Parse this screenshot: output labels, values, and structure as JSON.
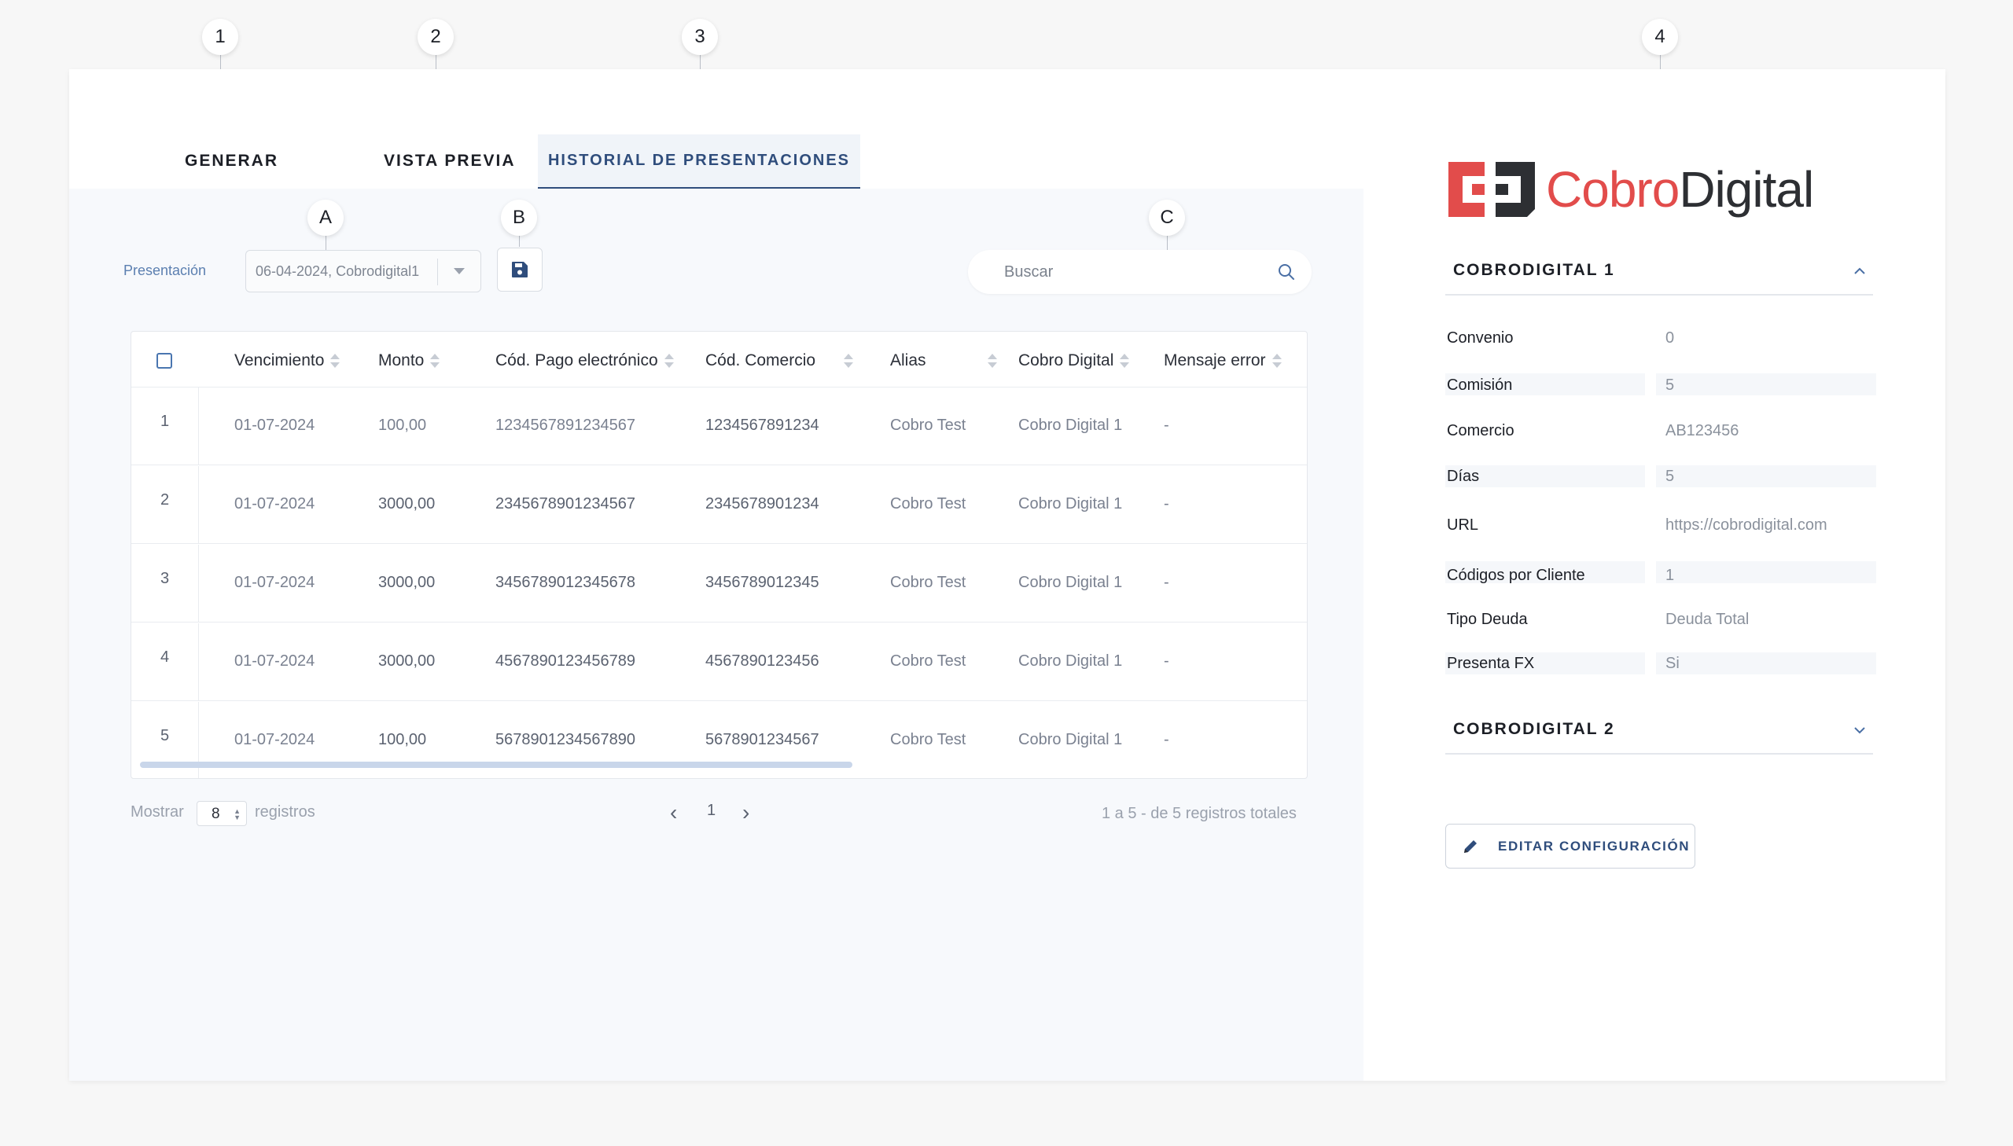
{
  "markers": {
    "m1": "1",
    "m2": "2",
    "m3": "3",
    "m4": "4",
    "mA": "A",
    "mB": "B",
    "mC": "C"
  },
  "tabs": {
    "generar": "GENERAR",
    "vista_previa": "VISTA PREVIA",
    "historial": "HISTORIAL DE PRESENTACIONES"
  },
  "toolbar": {
    "presentacion_label": "Presentación",
    "presentacion_value": "06-04-2024, Cobrodigital1",
    "search_placeholder": "Buscar"
  },
  "table": {
    "headers": {
      "vencimiento": "Vencimiento",
      "monto": "Monto",
      "cod_pago": "Cód. Pago electrónico",
      "cod_comercio": "Cód. Comercio",
      "alias": "Alias",
      "cobro_digital": "Cobro Digital",
      "mensaje_error": "Mensaje error"
    },
    "rows": [
      {
        "idx": "1",
        "vencimiento": "01-07-2024",
        "monto": "100,00",
        "cod_pago": "1234567891234567",
        "cod_comercio": "1234567891234",
        "alias": "Cobro Test",
        "cobro_digital": "Cobro Digital 1",
        "mensaje_error": "-"
      },
      {
        "idx": "2",
        "vencimiento": "01-07-2024",
        "monto": "3000,00",
        "cod_pago": "2345678901234567",
        "cod_comercio": "2345678901234",
        "alias": "Cobro Test",
        "cobro_digital": "Cobro Digital 1",
        "mensaje_error": "-"
      },
      {
        "idx": "3",
        "vencimiento": "01-07-2024",
        "monto": "3000,00",
        "cod_pago": "3456789012345678",
        "cod_comercio": "3456789012345",
        "alias": "Cobro Test",
        "cobro_digital": "Cobro Digital 1",
        "mensaje_error": "-"
      },
      {
        "idx": "4",
        "vencimiento": "01-07-2024",
        "monto": "3000,00",
        "cod_pago": "4567890123456789",
        "cod_comercio": "4567890123456",
        "alias": "Cobro Test",
        "cobro_digital": "Cobro Digital 1",
        "mensaje_error": "-"
      },
      {
        "idx": "5",
        "vencimiento": "01-07-2024",
        "monto": "100,00",
        "cod_pago": "5678901234567890",
        "cod_comercio": "5678901234567",
        "alias": "Cobro Test",
        "cobro_digital": "Cobro Digital 1",
        "mensaje_error": "-"
      }
    ]
  },
  "footer": {
    "mostrar": "Mostrar",
    "page_size": "8",
    "registros": "registros",
    "current_page": "1",
    "summary": "1 a 5 - de 5 registros totales"
  },
  "right_panel": {
    "logo_part1": "Cobro",
    "logo_part2": "Digital",
    "section1_title": "COBRODIGITAL 1",
    "section2_title": "COBRODIGITAL 2",
    "fields": [
      {
        "key": "Convenio",
        "value": "0"
      },
      {
        "key": "Comisión",
        "value": "5"
      },
      {
        "key": "Comercio",
        "value": "AB123456"
      },
      {
        "key": "Días",
        "value": "5"
      },
      {
        "key": "URL",
        "value": "https://cobrodigital.com"
      },
      {
        "key": "Códigos por Cliente",
        "value": "1"
      },
      {
        "key": "Tipo Deuda",
        "value": "Deuda Total"
      },
      {
        "key": "Presenta FX",
        "value": "Si"
      }
    ],
    "edit_button": "EDITAR CONFIGURACIÓN"
  },
  "colors": {
    "accent": "#2f4d7c",
    "brand_red": "#e24c4b",
    "brand_dark": "#2d2f33",
    "link_label": "#5b7fb0"
  }
}
